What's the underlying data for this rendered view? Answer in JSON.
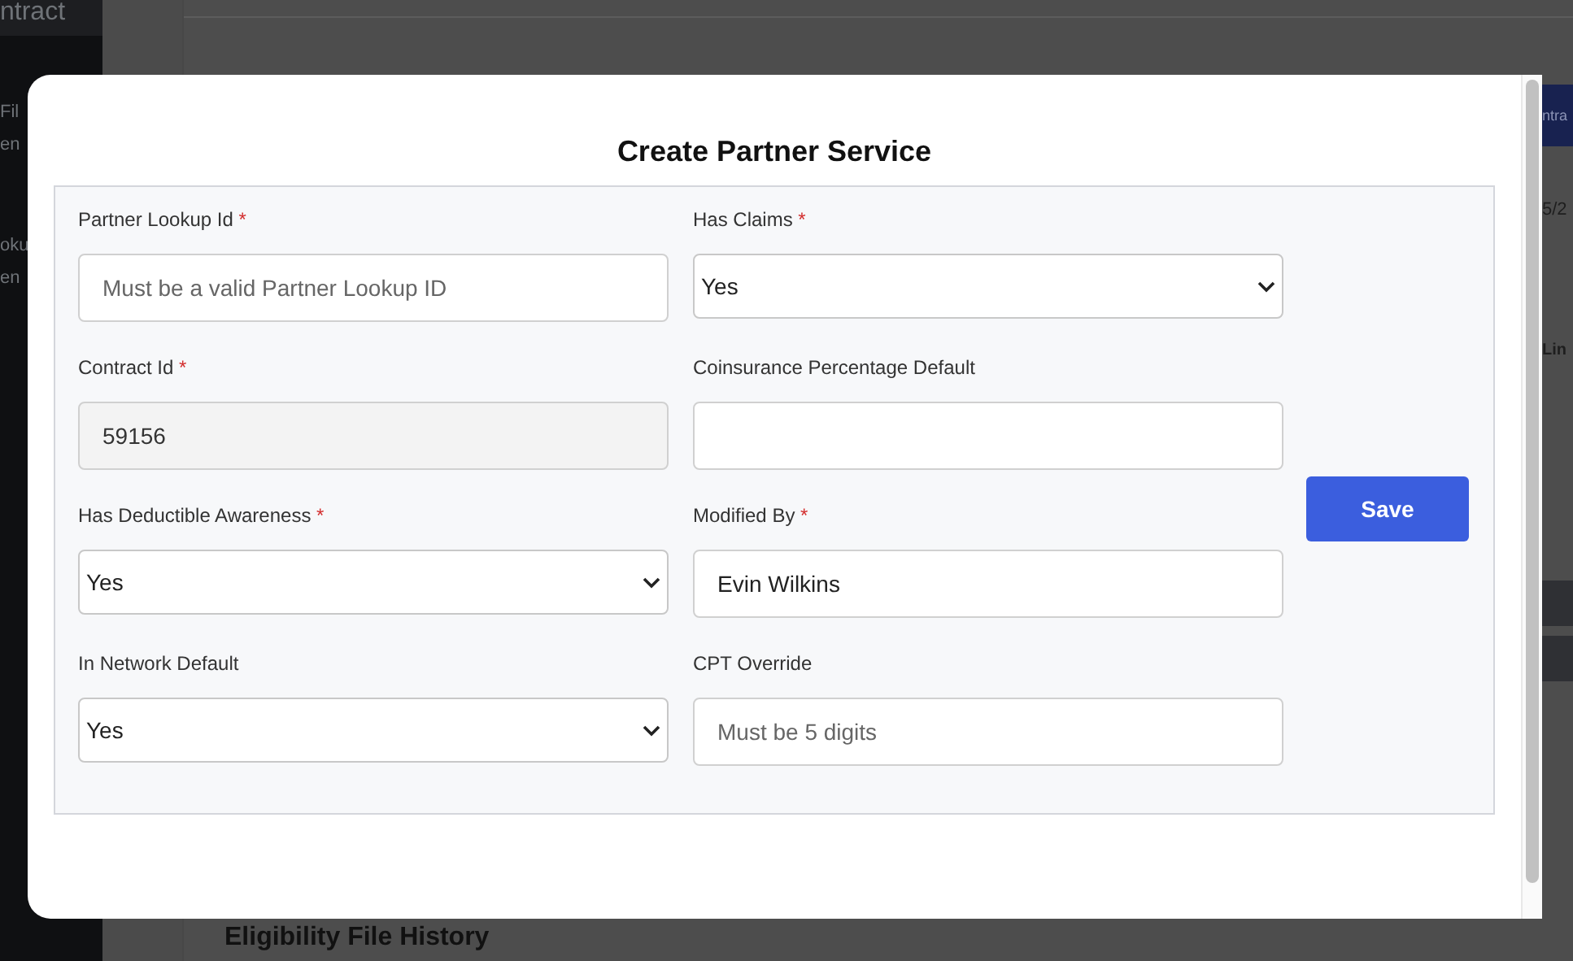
{
  "background": {
    "sidebar_items": [
      "ntract",
      "Fil",
      "en",
      "oku",
      "en"
    ],
    "header_button": "ntra",
    "date_fragment": "5/2",
    "label_fragment": "Lin",
    "section_title": "Eligibility File History"
  },
  "dialog": {
    "title": "Create Partner Service",
    "fields": [
      {
        "label": "Partner Lookup Id",
        "required_mark": "*",
        "kind": "text",
        "placeholder": "Must be a valid Partner Lookup ID",
        "disabled": false
      },
      {
        "label": "Has Claims",
        "required_mark": "*",
        "kind": "select",
        "value": "Yes",
        "disabled": false
      },
      {
        "label": "Contract Id",
        "required_mark": "*",
        "kind": "text",
        "value": "59156",
        "disabled": true
      },
      {
        "label": "Coinsurance Percentage Default",
        "kind": "text",
        "disabled": false
      },
      {
        "label": "Has Deductible Awareness",
        "required_mark": "*",
        "kind": "select",
        "value": "Yes",
        "disabled": false
      },
      {
        "label": "Modified By",
        "required_mark": "*",
        "kind": "text",
        "value": "Evin Wilkins",
        "disabled": false
      },
      {
        "label": "In Network Default",
        "kind": "select",
        "value": "Yes",
        "disabled": false
      },
      {
        "label": "CPT Override",
        "kind": "text",
        "placeholder": "Must be 5 digits",
        "disabled": false
      }
    ],
    "save_button": "Save"
  }
}
